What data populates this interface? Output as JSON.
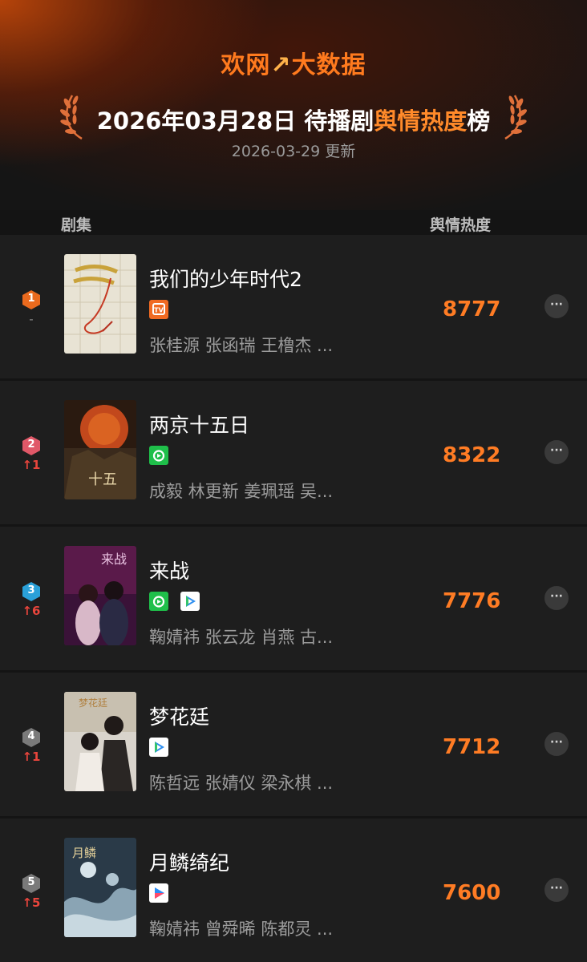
{
  "header": {
    "brand_text": "欢网",
    "brand_mark": "↗",
    "brand_suffix": "大数据",
    "title_prefix": "2026年03月28日 待播剧",
    "title_highlight": "舆情热度",
    "title_suffix": "榜",
    "update_text": "2026-03-29 更新"
  },
  "columns": {
    "series": "剧集",
    "heat": "舆情热度"
  },
  "colors": {
    "accent": "#ff7c24",
    "rank_up": "#e8453c"
  },
  "rows": [
    {
      "rank": "1",
      "change": "-",
      "title": "我们的少年时代2",
      "platforms": [
        "mangotv-icon"
      ],
      "cast": "张桂源 张函瑞 王橹杰 ...",
      "heat": "8777",
      "more_label": "···"
    },
    {
      "rank": "2",
      "change": "↑1",
      "title": "两京十五日",
      "platforms": [
        "iqiyi-icon"
      ],
      "cast": "成毅 林更新 姜珮瑶 吴...",
      "heat": "8322",
      "more_label": "···"
    },
    {
      "rank": "3",
      "change": "↑6",
      "title": "来战",
      "platforms": [
        "iqiyi-icon",
        "tencent-video-icon"
      ],
      "cast": "鞠婧祎 张云龙 肖燕 古...",
      "heat": "7776",
      "more_label": "···"
    },
    {
      "rank": "4",
      "change": "↑1",
      "title": "梦花廷",
      "platforms": [
        "tencent-video-icon"
      ],
      "cast": "陈哲远 张婧仪 梁永棋 ...",
      "heat": "7712",
      "more_label": "···"
    },
    {
      "rank": "5",
      "change": "↑5",
      "title": "月鳞绮纪",
      "platforms": [
        "youku-icon"
      ],
      "cast": "鞠婧祎 曾舜晞 陈都灵 ...",
      "heat": "7600",
      "more_label": "···"
    }
  ]
}
